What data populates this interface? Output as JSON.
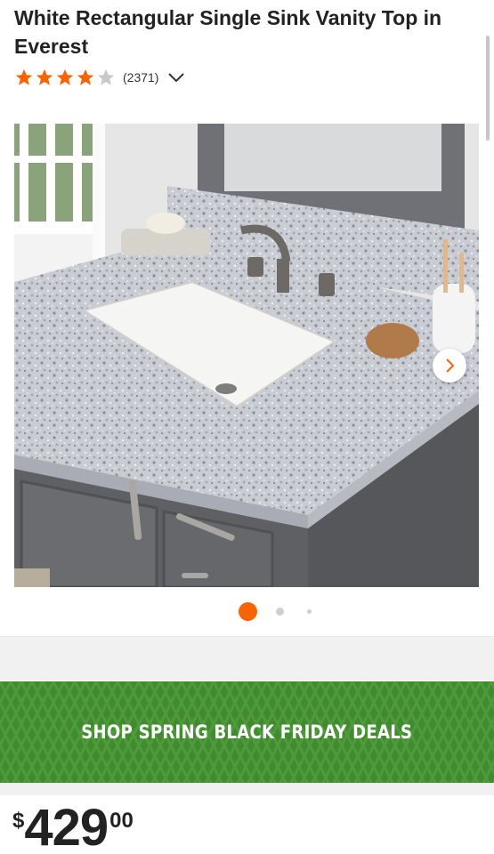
{
  "product": {
    "title": "White Rectangular Single Sink Vanity Top in Everest",
    "rating_value": 4,
    "rating_max": 5,
    "review_count": "(2371)"
  },
  "gallery": {
    "image_count": 3,
    "active_index": 0
  },
  "promo": {
    "text": "SHOP SPRING BLACK FRIDAY DEALS",
    "color": "#3f8b2e"
  },
  "price": {
    "currency": "$",
    "dollars": "429",
    "cents": "00"
  },
  "colors": {
    "accent": "#f96302",
    "star_empty": "#c8c8c8"
  }
}
